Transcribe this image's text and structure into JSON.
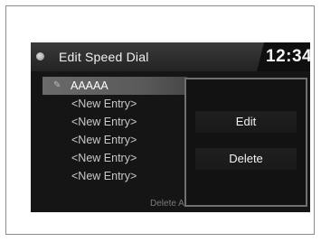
{
  "header": {
    "title": "Edit Speed Dial",
    "clock": "12:34"
  },
  "entries": [
    {
      "label": "AAAAA",
      "selected": true
    },
    {
      "label": "<New Entry>",
      "selected": false
    },
    {
      "label": "<New Entry>",
      "selected": false
    },
    {
      "label": "<New Entry>",
      "selected": false
    },
    {
      "label": "<New Entry>",
      "selected": false
    },
    {
      "label": "<New Entry>",
      "selected": false
    }
  ],
  "footer": {
    "delete_all_label": "Delete All"
  },
  "popup": {
    "edit_label": "Edit",
    "delete_label": "Delete"
  },
  "icons": {
    "title_icon": "speed-dial-icon",
    "entry_icon": "edit-pencil-icon"
  }
}
